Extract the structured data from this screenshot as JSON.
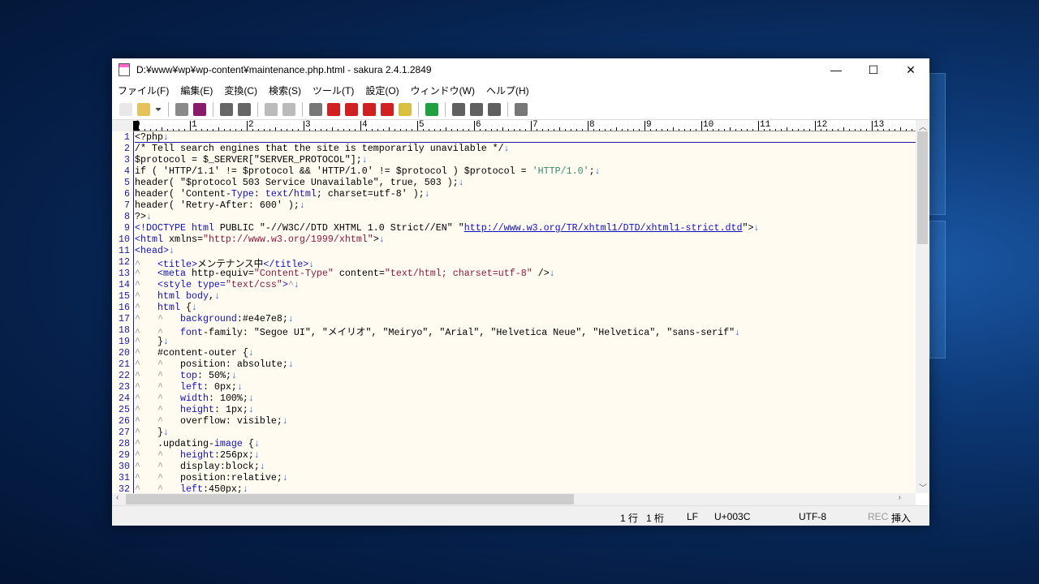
{
  "window": {
    "title": "D:¥www¥wp¥wp-content¥maintenance.php.html - sakura 2.4.1.2849",
    "minimize": "—",
    "maximize": "☐",
    "close": "✕"
  },
  "menu": [
    "ファイル(F)",
    "編集(E)",
    "変換(C)",
    "検索(S)",
    "ツール(T)",
    "設定(O)",
    "ウィンドウ(W)",
    "ヘルプ(H)"
  ],
  "toolbar": [
    {
      "name": "new-file-icon",
      "color": "#e8e8e8"
    },
    {
      "name": "open-folder-icon",
      "color": "#e6c25a"
    },
    {
      "name": "dropdown-icon",
      "color": "#444"
    },
    "sep",
    {
      "name": "save-icon",
      "color": "#8a8a8a"
    },
    {
      "name": "save-all-icon",
      "color": "#8a1a6a"
    },
    "sep",
    {
      "name": "undo-icon",
      "color": "#666"
    },
    {
      "name": "redo-icon",
      "color": "#666"
    },
    "sep",
    {
      "name": "back-icon",
      "color": "#bbb"
    },
    {
      "name": "forward-icon",
      "color": "#bbb"
    },
    "sep",
    {
      "name": "search-icon",
      "color": "#777"
    },
    {
      "name": "search-down-icon",
      "color": "#d02020"
    },
    {
      "name": "search-up-icon",
      "color": "#d02020"
    },
    {
      "name": "replace-icon",
      "color": "#d02020"
    },
    {
      "name": "clear-mark-icon",
      "color": "#d02020"
    },
    {
      "name": "grep-icon",
      "color": "#d8c040"
    },
    "sep",
    {
      "name": "outline-icon",
      "color": "#20a040"
    },
    "sep",
    {
      "name": "settings-common-icon",
      "color": "#606060"
    },
    {
      "name": "settings-type-icon",
      "color": "#606060"
    },
    {
      "name": "settings-font-icon",
      "color": "#606060"
    },
    "sep",
    {
      "name": "window-list-icon",
      "color": "#777"
    }
  ],
  "ruler": [
    "0",
    "1",
    "2",
    "3",
    "4",
    "5",
    "6",
    "7",
    "8",
    "9",
    "10",
    "11",
    "12",
    "13"
  ],
  "lines": [
    [
      [
        "<?php",
        ""
      ]
    ],
    [
      [
        "/* Tell search engines that the site is temporarily unavilable */",
        "cm"
      ]
    ],
    [
      [
        "$protocol = $_SERVER[\"SERVER_PROTOCOL\"];",
        ""
      ]
    ],
    [
      [
        "if ( 'HTTP/1.1' != $protocol && 'HTTP/1.0' != $protocol ) $protocol = ",
        ""
      ],
      [
        "'HTTP/1.0'",
        "str2"
      ],
      [
        ";",
        ""
      ]
    ],
    [
      [
        "header( \"$protocol 503 Service Unavailable\", true, 503 );",
        ""
      ]
    ],
    [
      [
        "header( 'Content-",
        ""
      ],
      [
        "Type",
        "kw"
      ],
      [
        ": ",
        ""
      ],
      [
        "text",
        "kw"
      ],
      [
        "/",
        ""
      ],
      [
        "html",
        "kw"
      ],
      [
        "; charset=utf-8' );",
        ""
      ]
    ],
    [
      [
        "header( 'Retry-After: 600' );",
        ""
      ]
    ],
    [
      [
        "?>",
        ""
      ]
    ],
    [
      [
        "<!DOCTYPE html",
        "kw"
      ],
      [
        " PUBLIC \"-//W3C//DTD XHTML 1.0 Strict//EN\" \"",
        ""
      ],
      [
        "http://www.w3.org/TR/xhtml1/DTD/xhtml1-strict.dtd",
        "url"
      ],
      [
        "\">",
        ""
      ]
    ],
    [
      [
        "<html",
        "kw"
      ],
      [
        " xmlns=",
        ""
      ],
      [
        "\"http://www.w3.org/1999/xhtml\"",
        "str"
      ],
      [
        ">",
        ""
      ]
    ],
    [
      [
        "<head>",
        "kw"
      ]
    ],
    [
      [
        "^   ",
        "tab"
      ],
      [
        "<title>",
        "kw"
      ],
      [
        "メンテナンス中",
        ""
      ],
      [
        "</title>",
        "kw"
      ]
    ],
    [
      [
        "^   ",
        "tab"
      ],
      [
        "<meta",
        "kw"
      ],
      [
        " http-equiv=",
        ""
      ],
      [
        "\"Content-Type\"",
        "str"
      ],
      [
        " content=",
        ""
      ],
      [
        "\"text/html; charset=utf-8\"",
        "str"
      ],
      [
        " />",
        ""
      ]
    ],
    [
      [
        "^   ",
        "tab"
      ],
      [
        "<style type=",
        "kw"
      ],
      [
        "\"text/css\"",
        "str"
      ],
      [
        ">",
        "kw"
      ],
      [
        "^",
        "tab"
      ]
    ],
    [
      [
        "^   ",
        "tab"
      ],
      [
        "html body",
        "kw"
      ],
      [
        ",",
        ""
      ]
    ],
    [
      [
        "^   ",
        "tab"
      ],
      [
        "html",
        "kw"
      ],
      [
        " {",
        ""
      ]
    ],
    [
      [
        "^   ^   ",
        "tab"
      ],
      [
        "background",
        "kw"
      ],
      [
        ":#e4e7e8;",
        ""
      ]
    ],
    [
      [
        "^   ^   ",
        "tab"
      ],
      [
        "font",
        "kw"
      ],
      [
        "-family: \"Segoe UI\", \"メイリオ\", \"Meiryo\", \"Arial\", \"Helvetica Neue\", \"Helvetica\", \"sans-serif\"",
        ""
      ]
    ],
    [
      [
        "^   ",
        "tab"
      ],
      [
        "}",
        ""
      ]
    ],
    [
      [
        "^   ",
        "tab"
      ],
      [
        "#content-outer {",
        ""
      ]
    ],
    [
      [
        "^   ^   ",
        "tab"
      ],
      [
        "position: absolute;",
        ""
      ]
    ],
    [
      [
        "^   ^   ",
        "tab"
      ],
      [
        "top",
        "kw"
      ],
      [
        ": 50%;",
        ""
      ]
    ],
    [
      [
        "^   ^   ",
        "tab"
      ],
      [
        "left",
        "kw"
      ],
      [
        ": 0px;",
        ""
      ]
    ],
    [
      [
        "^   ^   ",
        "tab"
      ],
      [
        "width",
        "kw"
      ],
      [
        ": 100%;",
        ""
      ]
    ],
    [
      [
        "^   ^   ",
        "tab"
      ],
      [
        "height",
        "kw"
      ],
      [
        ": 1px;",
        ""
      ]
    ],
    [
      [
        "^   ^   ",
        "tab"
      ],
      [
        "overflow: visible;",
        ""
      ]
    ],
    [
      [
        "^   ",
        "tab"
      ],
      [
        "}",
        ""
      ]
    ],
    [
      [
        "^   ",
        "tab"
      ],
      [
        ".updating-",
        ""
      ],
      [
        "image",
        "kw"
      ],
      [
        " {",
        ""
      ]
    ],
    [
      [
        "^   ^   ",
        "tab"
      ],
      [
        "height",
        "kw"
      ],
      [
        ":256px;",
        ""
      ]
    ],
    [
      [
        "^   ^   ",
        "tab"
      ],
      [
        "display:block;",
        ""
      ]
    ],
    [
      [
        "^   ^   ",
        "tab"
      ],
      [
        "position:relative;",
        ""
      ]
    ],
    [
      [
        "^   ^   ",
        "tab"
      ],
      [
        "left",
        "kw"
      ],
      [
        ":450px;",
        ""
      ]
    ]
  ],
  "eol_mark": "↓",
  "status": {
    "row": "1 行",
    "col": "1 桁",
    "eol": "LF",
    "char": "U+003C",
    "encoding": "UTF-8",
    "rec": "REC",
    "mode": "挿入"
  }
}
